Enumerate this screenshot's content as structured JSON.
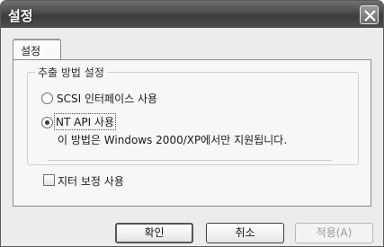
{
  "window": {
    "title": "설정",
    "close_icon": "close-icon"
  },
  "tabs": [
    {
      "label": "설정",
      "selected": true
    }
  ],
  "extraction": {
    "legend": "추출 방법 설정",
    "options": [
      {
        "label": "SCSI 인터페이스 사용",
        "selected": false
      },
      {
        "label": "NT API 사용",
        "selected": true,
        "note": "이 방법은 Windows 2000/XP에서만 지원됩니다."
      }
    ]
  },
  "jitter": {
    "label": "지터 보정 사용",
    "checked": false
  },
  "buttons": {
    "ok": "확인",
    "cancel": "취소",
    "apply": "적용(A)"
  }
}
